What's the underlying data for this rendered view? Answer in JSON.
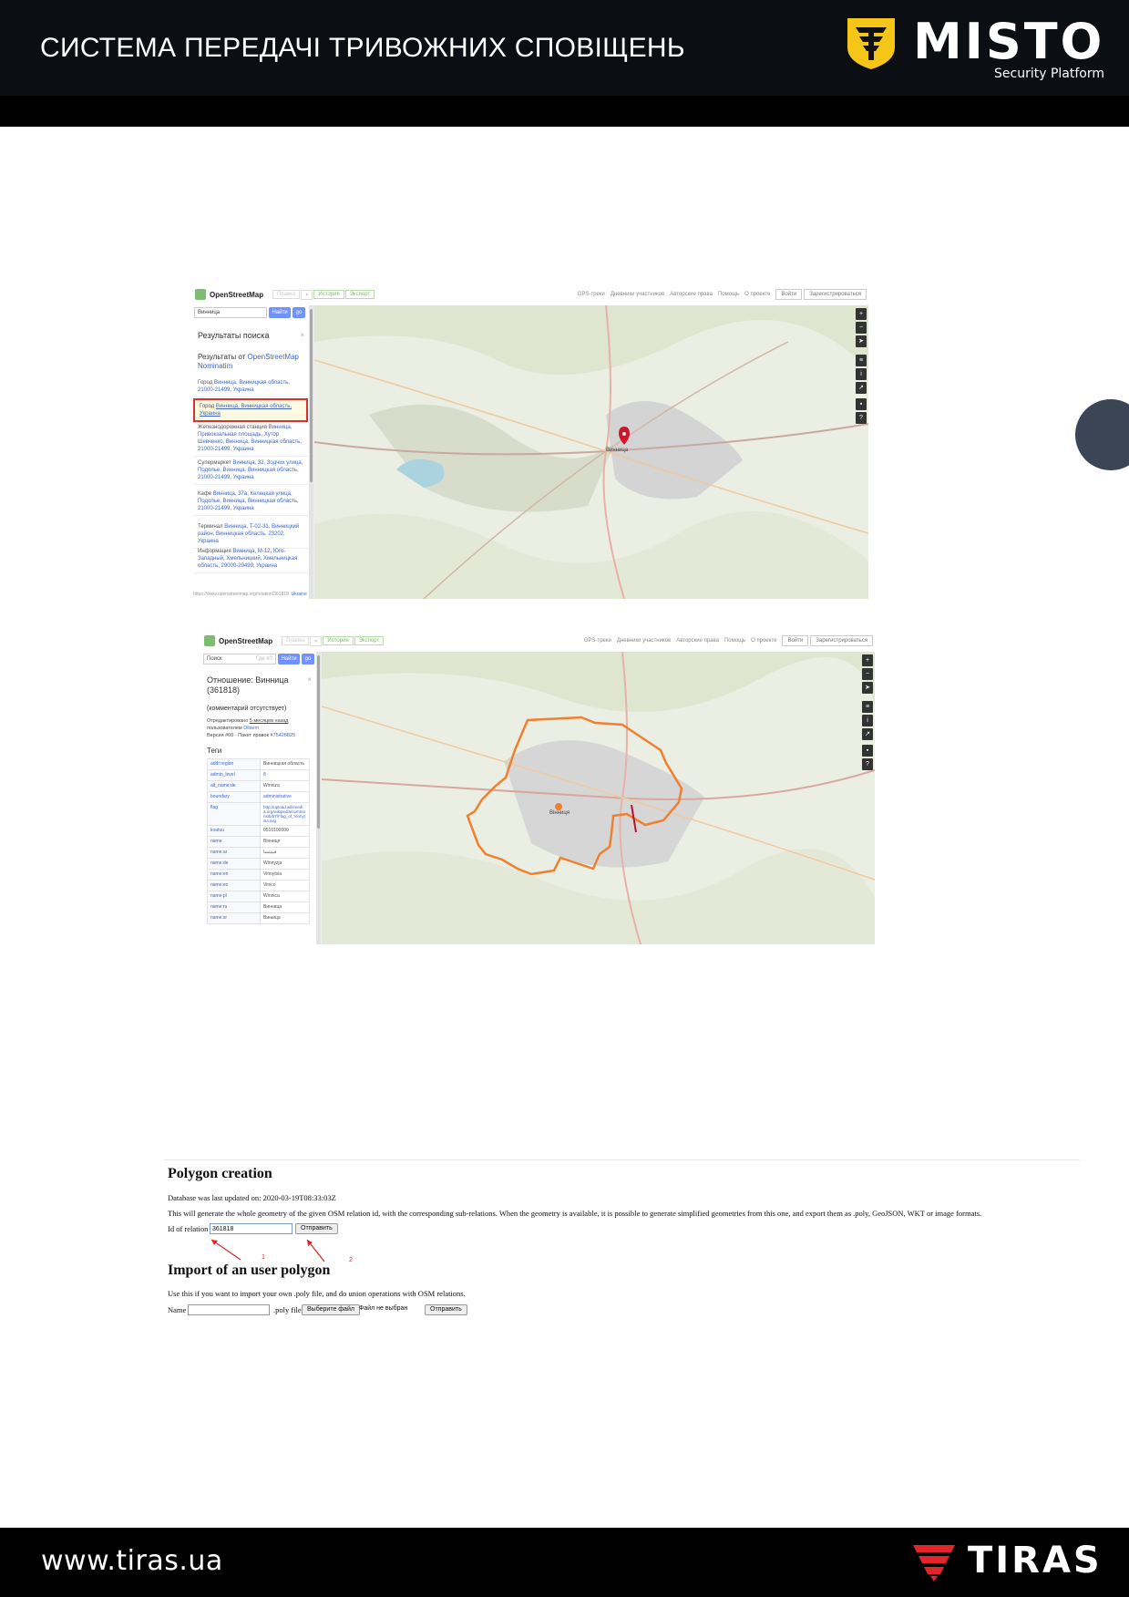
{
  "header": {
    "title": "СИСТЕМА ПЕРЕДАЧІ ТРИВОЖНИХ СПОВІЩЕНЬ",
    "brand": "MISTO",
    "brand_sub": "Security Platform",
    "brand_color": "#f5c518"
  },
  "osm1": {
    "brand": "OpenStreetMap",
    "tabs": [
      "Правка",
      "▾",
      "История",
      "Экспорт"
    ],
    "nav": [
      "GPS-треки",
      "Дневники участников",
      "Авторские права",
      "Помощь",
      "О проекте"
    ],
    "login": "Войти",
    "signup": "Зарегистрироваться",
    "search_value": "Винница",
    "find_label": "Найти",
    "go_label": "go",
    "results_title": "Результаты поиска",
    "results_from": "Результаты от ",
    "results_from_link": "OpenStreetMap Nominatim",
    "results": [
      {
        "prefix": "Город ",
        "link": "Винница",
        "rest": ", Винницкая область, 21000-21499, Украина"
      },
      {
        "prefix": "Город ",
        "link": "Винница, Винницкая область, Украина",
        "rest": ""
      },
      {
        "prefix": "Железнодорожная станция ",
        "link": "Винница",
        "rest": ", Привокзальная площадь, Хутор Шевченко, Винница, Винницкая область, 21000-21499, Украина"
      },
      {
        "prefix": "Супермаркет ",
        "link": "Винница",
        "rest": ", 32, Зодчих улица, Подолье, Винница, Винницкая область, 21000-21499, Украина"
      },
      {
        "prefix": "Кафе ",
        "link": "Винница",
        "rest": ", 37а, Келецкая улица, Подолье, Винница, Винницкая область, 21000-21499, Украина"
      },
      {
        "prefix": "Терминал ",
        "link": "Винница",
        "rest": ", Т-02-31, Винницкий район, Винницкая область, 23202, Украина"
      },
      {
        "prefix": "Информация ",
        "link": "Винница",
        "rest": ", М-12, Юго-Западный, Хмельницкий, Хмельницкая область, 29000-29499, Украина"
      }
    ],
    "footer_url": "https://www.openstreetmap.org/relation/361818",
    "footer_right": "Ukraine",
    "city_label": "Винница"
  },
  "osm2": {
    "brand": "OpenStreetMap",
    "tabs": [
      "Правка",
      "▾",
      "История",
      "Экспорт"
    ],
    "nav": [
      "GPS-треки",
      "Дневники участников",
      "Авторские права",
      "Помощь",
      "О проекте"
    ],
    "login": "Войти",
    "signup": "Зарегистрироваться",
    "search_placeholder": "Поиск",
    "search_hint": "Где я?",
    "find_label": "Найти",
    "go_label": "go",
    "relation_title": "Отношение: Винница (361818)",
    "no_comment": "(комментарий отсутствует)",
    "edited_prefix": "Отредактировано ",
    "edited_when": "5 месяцев назад",
    "edited_by": "пользователем ",
    "edited_user": "Dilsem",
    "version": "Версия #60 · Пакет правок #",
    "changeset": "75426825",
    "tags_title": "Теги",
    "tags": [
      {
        "k": "addr:region",
        "v": "Винницкая область"
      },
      {
        "k": "admin_level",
        "v": "8"
      },
      {
        "k": "alt_name:de",
        "v": "Winniza"
      },
      {
        "k": "boundary",
        "v": "administrative"
      },
      {
        "k": "flag",
        "v": "http://upload.wikimedia.org/wikipedia/commons/b/b7/Flag_of_Vinnytsia.svg"
      },
      {
        "k": "koatuu",
        "v": "0510100000"
      },
      {
        "k": "name",
        "v": "Вінниця"
      },
      {
        "k": "name:ar",
        "v": "فينيتسا"
      },
      {
        "k": "name:de",
        "v": "Winnyzja"
      },
      {
        "k": "name:en",
        "v": "Vinnytsia"
      },
      {
        "k": "name:eo",
        "v": "Vinico"
      },
      {
        "k": "name:pl",
        "v": "Winnica"
      },
      {
        "k": "name:ru",
        "v": "Винница"
      },
      {
        "k": "name:sr",
        "v": "Вињица"
      }
    ],
    "city_label": "Вінниця"
  },
  "polygon": {
    "title": "Polygon creation",
    "updated": "Database was last updated on: 2020-03-19T08:33:03Z",
    "description": "This will generate the whole geometry of the given OSM relation id, with the corresponding sub-relations. When the geometry is available, it is possible to generate simplified geometries from this one, and export them as .poly, GeoJSON, WKT or image formats.",
    "id_label": "Id of relation",
    "id_value": "361818",
    "submit_label": "Отправить",
    "marker_1": "1",
    "marker_2": "2",
    "import_title": "Import of an user polygon",
    "import_description": "Use this if you want to import your own .poly file, and do union operations with OSM relations.",
    "name_label": "Name",
    "poly_file_label": ".poly file",
    "choose_file_label": "Выберите файл",
    "no_file_label": "Файл не выбран",
    "import_submit_label": "Отправить"
  },
  "footer": {
    "url": "www.tiras.ua",
    "brand": "TIRAS",
    "brand_color": "#e2252b"
  }
}
